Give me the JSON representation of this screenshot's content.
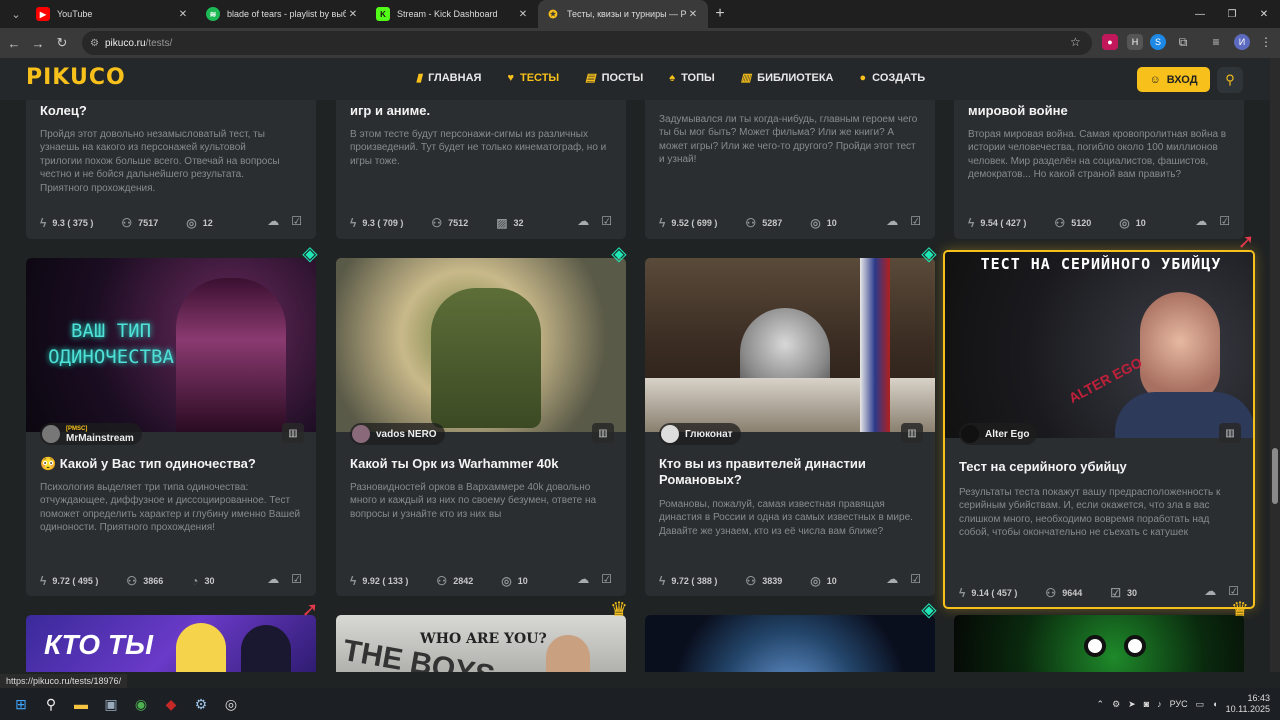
{
  "browser": {
    "tabs": [
      {
        "title": "YouTube",
        "icon": "youtube-icon",
        "color": "#ff0000"
      },
      {
        "title": "blade of tears - playlist by выб...",
        "icon": "spotify-icon",
        "color": "#1db954"
      },
      {
        "title": "Stream - Kick Dashboard",
        "icon": "kick-icon",
        "color": "#53fc18"
      },
      {
        "title": "Тесты, квизы и турниры — Pik...",
        "icon": "pikuco-icon",
        "color": "#f7c01a"
      }
    ],
    "url_host": "pikuco.ru",
    "url_path": "/tests/",
    "status_url": "https://pikuco.ru/tests/18976/"
  },
  "site": {
    "logo": "PIKUCO",
    "menu": [
      {
        "label": "ГЛАВНАЯ",
        "icon": "bookmark-icon"
      },
      {
        "label": "ТЕСТЫ",
        "icon": "masks-icon",
        "active": true
      },
      {
        "label": "ПОСТЫ",
        "icon": "document-icon"
      },
      {
        "label": "ТОПЫ",
        "icon": "flame-icon"
      },
      {
        "label": "БИБЛИОТЕКА",
        "icon": "book-icon"
      },
      {
        "label": "СОЗДАТЬ",
        "icon": "bulb-icon"
      }
    ],
    "login": "ВХОД",
    "accent": "#f7c01a"
  },
  "top_cards": [
    {
      "title": "Колец?",
      "desc": "Пройдя этот довольно незамысловатый тест, ты узнаешь на какого из персонажей культовой трилогии похож больше всего. Отвечай на вопросы честно и не бойся дальнейшего результата. Приятного прохождения.",
      "rating": "9.3",
      "votes": "375",
      "plays": "7517",
      "questions": "12"
    },
    {
      "title": "игр и аниме.",
      "desc": "В этом тесте будут персонажи-сигмы из различных произведений. Тут будет не только кинематограф, но и игры тоже.",
      "rating": "9.3",
      "votes": "709",
      "plays": "7512",
      "questions": "32"
    },
    {
      "title": "",
      "desc": "Задумывался ли ты когда-нибудь, главным героем чего ты бы мог быть? Может фильма? Или же книги? А может игры? Или же чего-то другого? Пройди этот тест и узнай!",
      "rating": "9.52",
      "votes": "699",
      "plays": "5287",
      "questions": "10"
    },
    {
      "title": "мировой войне",
      "desc": "Вторая мировая война. Самая кровопролитная война в истории человечества, погибло около 100 миллионов человек. Мир разделён на социалистов, фашистов, демократов... Но какой страной вам править?",
      "rating": "9.54",
      "votes": "427",
      "plays": "5120",
      "questions": "10"
    }
  ],
  "cards": [
    {
      "title": "😳 Какой у Вас тип одиночества?",
      "tag": "[PMSC]",
      "author": "MrMainstream",
      "image_text": "ВАШ ТИП ОДИНОЧЕСТВА",
      "desc": "Психология выделяет три типа одиночества: отчуждающее, диффузное и диссоциированное. Тест поможет определить характер и глубину именно Вашей одиноности. Приятного прохождения!",
      "rating": "9.72",
      "votes": "495",
      "plays": "3866",
      "questions": "30",
      "badge": "diamond-icon"
    },
    {
      "title": "Какой ты Орк из Warhammer 40k",
      "tag": "",
      "author": "vados NERO",
      "image_text": "",
      "desc": "Разновидностей орков в Вархаммере 40k довольно много и каждый из них по своему безумен, ответе на вопросы и узнайте кто из них вы",
      "rating": "9.92",
      "votes": "133",
      "plays": "2842",
      "questions": "10",
      "badge": "diamond-icon"
    },
    {
      "title": "Кто вы из правителей династии Романовых?",
      "tag": "",
      "author": "Глюконат",
      "image_text": "",
      "desc": "Романовы, пожалуй, самая известная правящая династия в России и одна из самых известных в мире. Давайте же узнаем, кто из её числа вам ближе?",
      "rating": "9.72",
      "votes": "388",
      "plays": "3839",
      "questions": "10",
      "badge": "diamond-icon"
    },
    {
      "title": "Тест на серийного убийцу",
      "tag": "",
      "author": "Alter Ego",
      "image_text": "ТЕСТ НА СЕРИЙНОГО УБИЙЦУ",
      "image_text2": "ALTER EGO",
      "desc": "Результаты теста покажут вашу предрасположенность к серийным убийствам. И, если окажется, что зла в вас слишком много, необходимо вовремя поработать над собой, чтобы окончательно не съехать с катушек",
      "rating": "9.14",
      "votes": "457",
      "plays": "9644",
      "questions": "30",
      "badge": "rocket-icon"
    }
  ],
  "bottom_cards": [
    {
      "image_text": "КТО ТЫ",
      "badge": "rocket-icon"
    },
    {
      "image_text": "WHO ARE YOU?",
      "image_text2": "THE BOYS",
      "badge": "crown-icon"
    },
    {
      "image_text": "",
      "badge": "diamond-icon"
    },
    {
      "image_text": "",
      "badge": "crown-icon"
    }
  ],
  "taskbar": {
    "lang": "РУС",
    "time": "16:43",
    "date": "10.11.2025"
  }
}
